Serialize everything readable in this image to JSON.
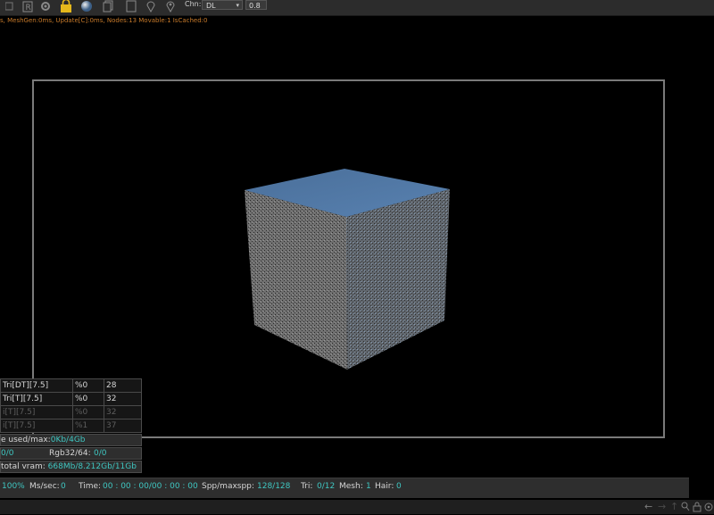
{
  "toolbar": {
    "icons": [
      "render-r-icon",
      "gear-icon",
      "lock-icon",
      "sphere-icon",
      "copy-icon",
      "document-icon",
      "pin-icon",
      "location-icon"
    ],
    "render_label": "R",
    "channel_label": "Chn:",
    "channel_value": "DL",
    "value_field": "0.8"
  },
  "status_line": "s, MeshGen:0ms, Update[C]:0ms, Nodes:13 Movable:1 IsCached:0",
  "stats": [
    {
      "label": "Tri[DT][7.5]",
      "percent": "%0",
      "value": "28",
      "dim": false
    },
    {
      "label": "Tri[T][7.5]",
      "percent": "%0",
      "value": "32",
      "dim": false
    },
    {
      "label": "i[T][7.5]",
      "percent": "%0",
      "value": "32",
      "dim": true
    },
    {
      "label": "i[T][7.5]",
      "percent": "%1",
      "value": "37",
      "dim": true
    }
  ],
  "memory": {
    "used_label": "e used/max:",
    "used_value": "0Kb/4Gb",
    "left_value": "0/0",
    "rgb_label": "Rgb32/64:",
    "rgb_value": "0/0",
    "vram_label": "total vram:",
    "vram_value": "668Mb/8.212Gb/11Gb"
  },
  "bottom": {
    "progress": "100%",
    "ms_label": "Ms/sec:",
    "ms_value": "0",
    "time_label": "Time:",
    "time_value": "00 : 00 : 00/00 : 00 : 00",
    "spp_label": "Spp/maxspp:",
    "spp_value": "128/128",
    "tri_label": "Tri:",
    "tri_value": "0/12",
    "mesh_label": "Mesh:",
    "mesh_value": "1",
    "hair_label": "Hair:",
    "hair_value": "0"
  },
  "nav_icons": [
    "arrow-left-icon",
    "arrow-right-icon",
    "arrow-up-icon",
    "zoom-icon",
    "lock-icon",
    "settings-icon"
  ],
  "colors": {
    "accent_teal": "#3fc6c1",
    "status_orange": "#c77a2a",
    "cube_top": "#4e78a6",
    "cube_side": "#6b6b6b"
  }
}
